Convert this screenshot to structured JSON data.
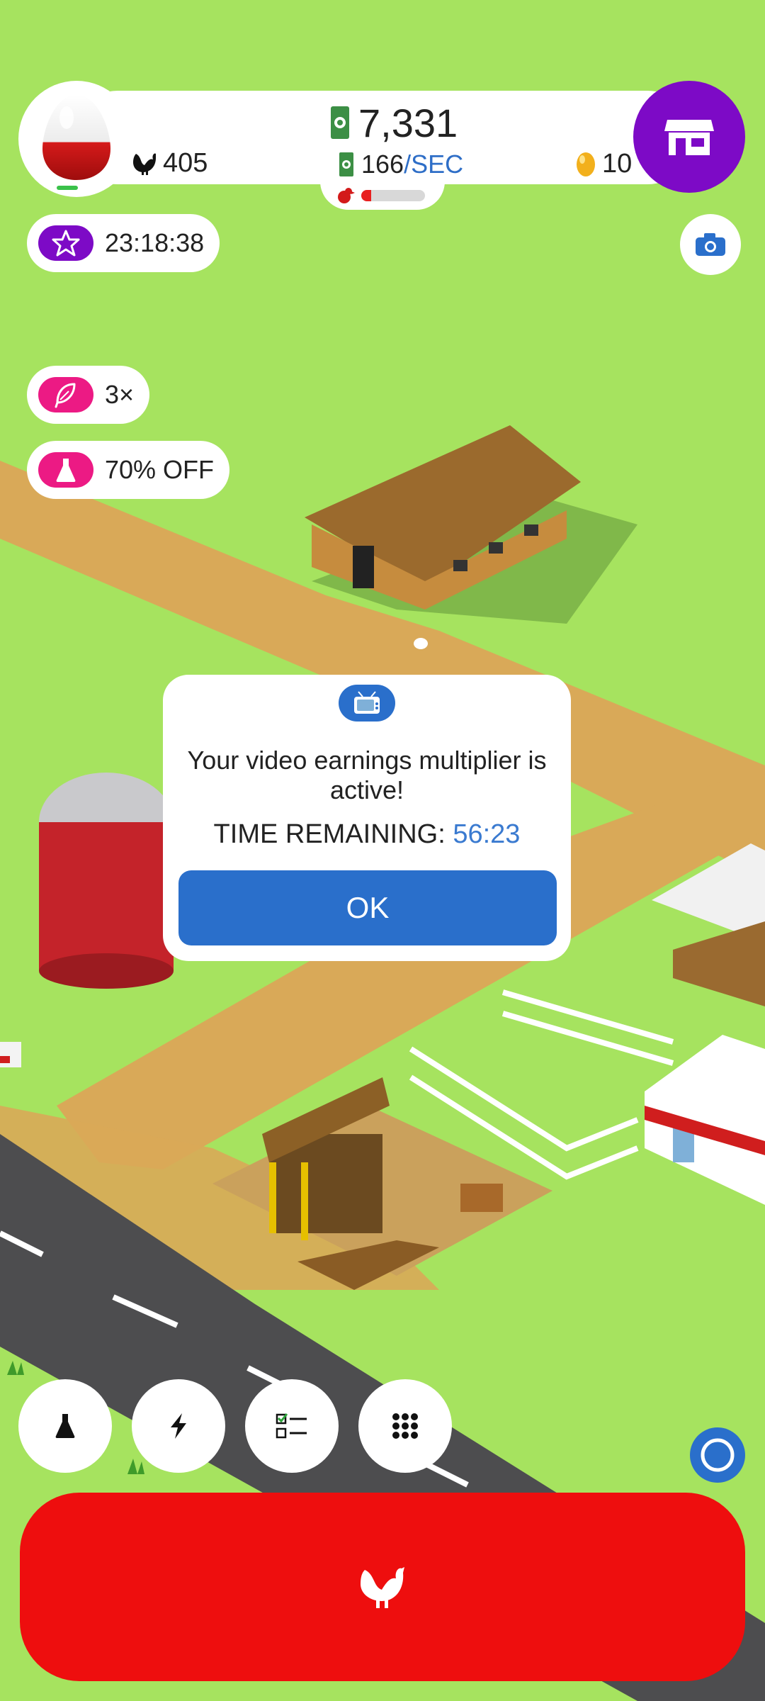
{
  "hud": {
    "chicken_count": "405",
    "money": "7,331",
    "money_rate": "166",
    "money_rate_unit": "/SEC",
    "golden_eggs": "10",
    "egg_progress": 0.15
  },
  "boosts": [
    {
      "icon": "star-icon",
      "label": "23:18:38",
      "color": "#7d0ac6"
    },
    {
      "icon": "feather-icon",
      "label": "3×",
      "color": "#ec1a84"
    },
    {
      "icon": "flask-icon",
      "label": "70% OFF",
      "color": "#ec1a84"
    }
  ],
  "dialog": {
    "icon": "tv-icon",
    "message": "Your video earnings multiplier is active!",
    "time_label": "TIME REMAINING:",
    "time_value": "56:23",
    "ok_label": "OK"
  },
  "bottom_buttons": [
    {
      "name": "research-button",
      "icon": "flask-icon"
    },
    {
      "name": "boost-button",
      "icon": "lightning-icon"
    },
    {
      "name": "quests-button",
      "icon": "checklist-icon"
    },
    {
      "name": "menu-button",
      "icon": "grid-icon"
    }
  ],
  "colors": {
    "grass": "#a6e35f",
    "road": "#4d4d4f",
    "path": "#d9a958",
    "accent_blue": "#2a6fcb",
    "shop_purple": "#7d0ac6",
    "spawn_red": "#ee0e0e"
  }
}
